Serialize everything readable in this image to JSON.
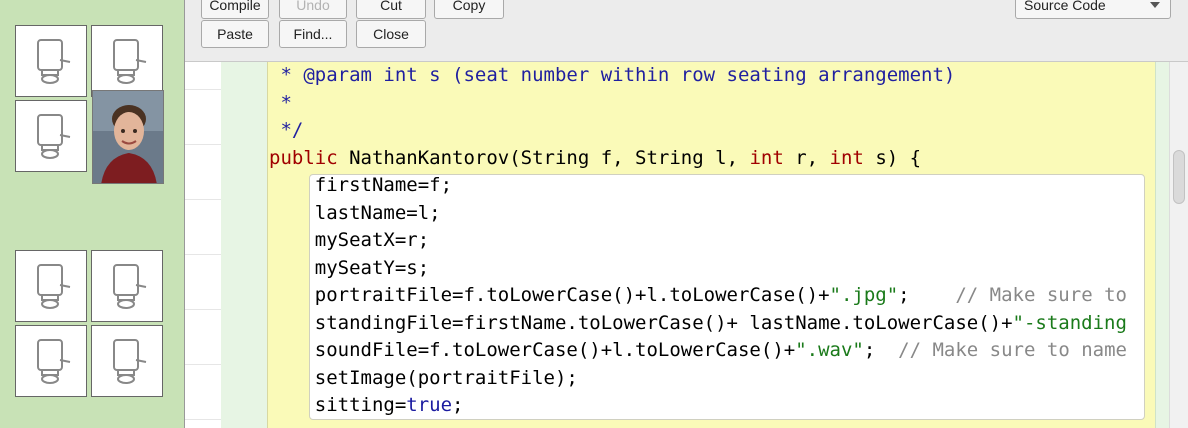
{
  "toolbar": {
    "row1": [
      "Compile",
      "Undo",
      "Cut",
      "Copy"
    ],
    "row2": [
      "Paste",
      "Find...",
      "Close"
    ],
    "view_select": "Source Code"
  },
  "code": {
    "lines": [
      {
        "tokens": [
          {
            "t": " * @param int s (seat number within row seating arrangement)",
            "c": "c-doc"
          }
        ]
      },
      {
        "tokens": [
          {
            "t": " *",
            "c": "c-doc"
          }
        ]
      },
      {
        "tokens": [
          {
            "t": " */",
            "c": "c-doc"
          }
        ]
      },
      {
        "tokens": [
          {
            "t": "public",
            "c": "c-kw"
          },
          {
            "t": " NathanKantorov(String f, String l, ",
            "c": ""
          },
          {
            "t": "int",
            "c": "c-kw"
          },
          {
            "t": " r, ",
            "c": ""
          },
          {
            "t": "int",
            "c": "c-kw"
          },
          {
            "t": " s) {",
            "c": ""
          }
        ]
      },
      {
        "tokens": [
          {
            "t": "    firstName=f;",
            "c": ""
          }
        ]
      },
      {
        "tokens": [
          {
            "t": "    lastName=l;",
            "c": ""
          }
        ]
      },
      {
        "tokens": [
          {
            "t": "    mySeatX=r;",
            "c": ""
          }
        ]
      },
      {
        "tokens": [
          {
            "t": "    mySeatY=s;",
            "c": ""
          }
        ]
      },
      {
        "tokens": [
          {
            "t": "    portraitFile=f.toLowerCase()+l.toLowerCase()+",
            "c": ""
          },
          {
            "t": "\".jpg\"",
            "c": "c-str"
          },
          {
            "t": ";    ",
            "c": ""
          },
          {
            "t": "// Make sure to",
            "c": "c-com"
          }
        ]
      },
      {
        "tokens": [
          {
            "t": "    standingFile=firstName.toLowerCase()+ lastName.toLowerCase()+",
            "c": ""
          },
          {
            "t": "\"-standing",
            "c": "c-str"
          }
        ]
      },
      {
        "tokens": [
          {
            "t": "    soundFile=f.toLowerCase()+l.toLowerCase()+",
            "c": ""
          },
          {
            "t": "\".wav\"",
            "c": "c-str"
          },
          {
            "t": ";  ",
            "c": ""
          },
          {
            "t": "// Make sure to name",
            "c": "c-com"
          }
        ]
      },
      {
        "tokens": [
          {
            "t": "    setImage(portraitFile);",
            "c": ""
          }
        ]
      },
      {
        "tokens": [
          {
            "t": "    sitting=",
            "c": ""
          },
          {
            "t": "true",
            "c": "c-true"
          },
          {
            "t": ";",
            "c": ""
          }
        ]
      }
    ]
  }
}
